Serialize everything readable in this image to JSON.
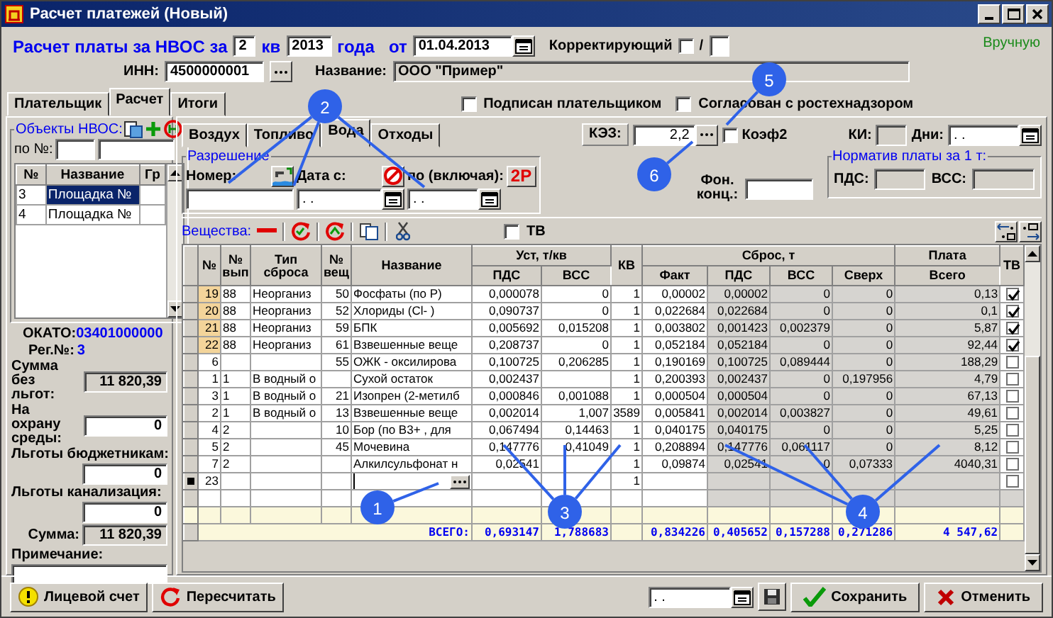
{
  "window": {
    "title": "Расчет платежей (Новый)"
  },
  "header": {
    "title_prefix": "Расчет платы за НВОС за",
    "quarter": "2",
    "quarter_label": "кв",
    "year": "2013",
    "year_label": "года",
    "date_label": "от",
    "date": "01.04.2013",
    "corrective_label": "Корректирующий",
    "corrective_checked": false,
    "corrective_sep": "/",
    "mode": "Вручную",
    "inn_label": "ИНН:",
    "inn": "4500000001",
    "name_label": "Название:",
    "name": "ООО \"Пример\""
  },
  "tabs": [
    {
      "label": "Плательщик",
      "selected": false
    },
    {
      "label": "Расчет",
      "selected": true
    },
    {
      "label": "Итоги",
      "selected": false
    }
  ],
  "approvals": [
    {
      "label": "Подписан плательщиком",
      "checked": false
    },
    {
      "label": "Согласован с ростехнадзором",
      "checked": false
    }
  ],
  "objects": {
    "title": "Объекты НВОС:",
    "filter_label": "по №:",
    "columns": [
      "№",
      "Название",
      "Гр"
    ],
    "rows": [
      {
        "number": "3",
        "name": "Площадка №",
        "selected": true
      },
      {
        "number": "4",
        "name": "Площадка №",
        "selected": false
      }
    ]
  },
  "summary": {
    "okato_label": "ОКАТО:",
    "okato": "03401000000",
    "reg_label": "Рег.№:",
    "reg": "3",
    "fields": [
      {
        "label": "Сумма без льгот:",
        "value": "11 820,39",
        "kind": "total"
      },
      {
        "label": "На охрану среды:",
        "value": "0",
        "kind": "entry"
      },
      {
        "label": "Льготы бюджетникам:",
        "value": "0",
        "kind": "benefit"
      },
      {
        "label": "Льготы канализация:",
        "value": "0",
        "kind": "benefit"
      },
      {
        "label": "Сумма:",
        "value": "11 820,39",
        "kind": "total"
      }
    ],
    "note_label": "Примечание:"
  },
  "media_tabs": [
    {
      "label": "Воздух",
      "selected": false
    },
    {
      "label": "Топливо",
      "selected": false
    },
    {
      "label": "Вода",
      "selected": true
    },
    {
      "label": "Отходы",
      "selected": false
    }
  ],
  "coefficients": {
    "kez_label": "КЭЗ:",
    "kez": "2,2",
    "coef2_label": "Коэф2",
    "coef2_checked": false,
    "ki_label": "КИ:",
    "days_label": "Дни:",
    "days": ". ."
  },
  "permit": {
    "title": "Разрешение",
    "number_label": "Номер:",
    "date_from_label": "Дата с:",
    "date_to_label": "по (включая):",
    "copy_button": "2P",
    "date_from": ". .",
    "date_to": ". ."
  },
  "background_label": "Фон. конц.:",
  "norm": {
    "title": "Норматив платы за 1 т:",
    "pds_label": "ПДС:",
    "vss_label": "ВСС:"
  },
  "substances": {
    "title": "Вещества:",
    "tv_label": "ТВ",
    "tv_checked": false,
    "columns": [
      {
        "label": "№"
      },
      {
        "label": "№ вып"
      },
      {
        "label": "Тип сброса"
      },
      {
        "label": "№ вещ"
      },
      {
        "label": "Название"
      },
      {
        "title": "Уст, т/кв",
        "columns": [
          {
            "label": "ПДС"
          },
          {
            "label": "ВСС"
          }
        ]
      },
      {
        "label": "КВ"
      },
      {
        "title": "Сброс, т",
        "columns": [
          {
            "label": "Факт"
          },
          {
            "label": "ПДС"
          },
          {
            "label": "ВСС"
          },
          {
            "label": "Сверх"
          }
        ]
      },
      {
        "title": "Плата",
        "columns": [
          {
            "label": "Всего"
          }
        ]
      },
      {
        "label": "ТВ"
      }
    ],
    "rows": [
      {
        "kind": "data",
        "highlighted": true,
        "tv_checked": true,
        "cells": [
          "19",
          "88",
          "Неорганиз",
          "50",
          "Фосфаты (по P)",
          "0,000078",
          "0",
          "1",
          "0,00002",
          "0,00002",
          "0",
          "0",
          "0,13"
        ]
      },
      {
        "kind": "data",
        "highlighted": true,
        "tv_checked": true,
        "cells": [
          "20",
          "88",
          "Неорганиз",
          "52",
          "Хлориды (Cl- )",
          "0,090737",
          "0",
          "1",
          "0,022684",
          "0,022684",
          "0",
          "0",
          "0,1"
        ]
      },
      {
        "kind": "data",
        "highlighted": true,
        "tv_checked": true,
        "cells": [
          "21",
          "88",
          "Неорганиз",
          "59",
          "БПК",
          "0,005692",
          "0,015208",
          "1",
          "0,003802",
          "0,001423",
          "0,002379",
          "0",
          "5,87"
        ]
      },
      {
        "kind": "data",
        "highlighted": true,
        "tv_checked": true,
        "cells": [
          "22",
          "88",
          "Неорганиз",
          "61",
          "Взвешенные веще",
          "0,208737",
          "0",
          "1",
          "0,052184",
          "0,052184",
          "0",
          "0",
          "92,44"
        ]
      },
      {
        "kind": "data",
        "highlighted": false,
        "tv_checked": false,
        "cells": [
          "6",
          null,
          null,
          "55",
          "ОЖК - оксилирова",
          "0,100725",
          "0,206285",
          "1",
          "0,190169",
          "0,100725",
          "0,089444",
          "0",
          "188,29"
        ]
      },
      {
        "kind": "data",
        "highlighted": false,
        "tv_checked": false,
        "cells": [
          "1",
          "1",
          "В водный о",
          null,
          "Сухой остаток",
          "0,002437",
          null,
          "1",
          "0,200393",
          "0,002437",
          "0",
          "0,197956",
          "4,79"
        ]
      },
      {
        "kind": "data",
        "highlighted": false,
        "tv_checked": false,
        "cells": [
          "3",
          "1",
          "В водный о",
          "21",
          "Изопрен (2-метилб",
          "0,000846",
          "0,001088",
          "1",
          "0,000504",
          "0,000504",
          "0",
          "0",
          "67,13"
        ]
      },
      {
        "kind": "data",
        "highlighted": false,
        "tv_checked": false,
        "cells": [
          "2",
          "1",
          "В водный о",
          "13",
          "Взвешенные веще",
          "0,002014",
          "1,007",
          "3589",
          "0,005841",
          "0,002014",
          "0,003827",
          "0",
          "49,61"
        ]
      },
      {
        "kind": "data",
        "highlighted": false,
        "tv_checked": false,
        "cells": [
          "4",
          "2",
          null,
          "10",
          "Бор (по B3+ , для",
          "0,067494",
          "0,14463",
          "1",
          "0,040175",
          "0,040175",
          "0",
          "0",
          "5,25"
        ]
      },
      {
        "kind": "data",
        "highlighted": false,
        "tv_checked": false,
        "cells": [
          "5",
          "2",
          null,
          "45",
          "Мочевина",
          "0,147776",
          "0,41049",
          "1",
          "0,208894",
          "0,147776",
          "0,061117",
          "0",
          "8,12"
        ]
      },
      {
        "kind": "data",
        "highlighted": false,
        "tv_checked": false,
        "cells": [
          "7",
          "2",
          null,
          null,
          "Алкилсульфонат н",
          "0,02541",
          null,
          "1",
          "0,09874",
          "0,02541",
          "0",
          "0,07333",
          "4040,31"
        ]
      },
      {
        "kind": "entry",
        "highlighted": false,
        "tv_checked": false,
        "cells": [
          "23",
          null,
          null,
          null,
          null,
          null,
          null,
          "1",
          null,
          null,
          null,
          null,
          null
        ]
      },
      {
        "kind": "blank"
      },
      {
        "kind": "filler"
      }
    ],
    "totals": {
      "label": "ВСЕГО:",
      "values": [
        "0,693147",
        "1,788683",
        "0,834226",
        "0,405652",
        "0,157288",
        "0,271286",
        "4 547,62"
      ]
    }
  },
  "footer": {
    "buttons": [
      {
        "label": "Лицевой счет"
      },
      {
        "label": "Пересчитать"
      }
    ],
    "date": ". .",
    "actions": [
      {
        "label": "Сохранить"
      },
      {
        "label": "Отменить"
      }
    ]
  },
  "callouts": [
    {
      "label": "1"
    },
    {
      "label": "2"
    },
    {
      "label": "3"
    },
    {
      "label": "4"
    },
    {
      "label": "5"
    },
    {
      "label": "6"
    }
  ]
}
